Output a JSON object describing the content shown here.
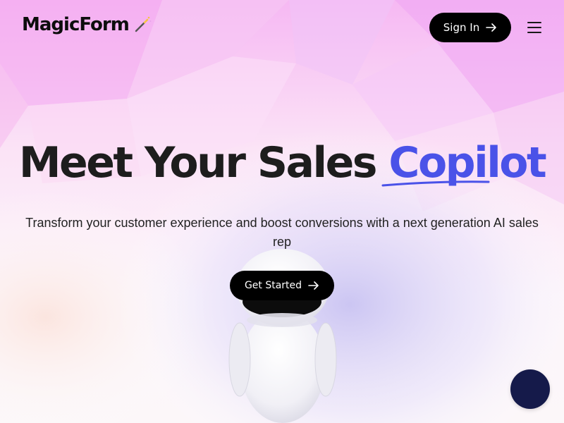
{
  "header": {
    "logo_text": "MagicForm",
    "logo_icon": "magic-wand-icon",
    "sign_in_label": "Sign In",
    "menu_icon": "hamburger-menu-icon"
  },
  "hero": {
    "title_main": "Meet Your Sales",
    "title_accent": "Copilot",
    "subtitle": "Transform your customer experience and boost conversions with a next generation AI sales rep",
    "cta_label": "Get Started",
    "illustration": "robot-illustration"
  },
  "chat_widget": {
    "icon": "chat-launcher"
  },
  "colors": {
    "accent": "#4a52e8",
    "button": "#000000",
    "chat_launcher": "#151a4a",
    "background_tint": "#f3a6f2"
  }
}
